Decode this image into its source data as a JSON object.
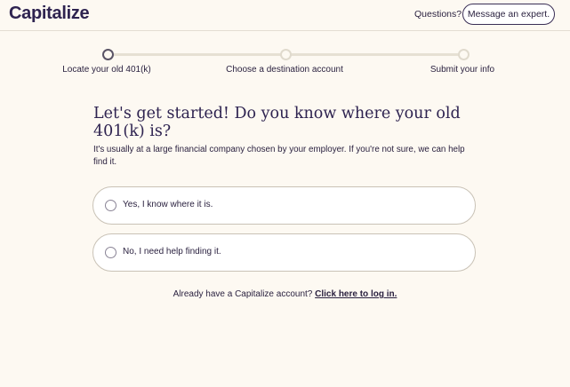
{
  "header": {
    "logo": "Capitalize",
    "questions_label": "Questions?",
    "message_button": "Message an expert."
  },
  "progress": {
    "current_step": 1,
    "steps": [
      {
        "label": "Locate your old 401(k)"
      },
      {
        "label": "Choose a destination account"
      },
      {
        "label": "Submit your info"
      }
    ]
  },
  "main": {
    "title": "Let's get started! Do you know where your old 401(k) is?",
    "subtitle": "It's usually at a large financial company chosen by your employer. If you're not sure, we can help find it.",
    "options": [
      {
        "label": "Yes, I know where it is."
      },
      {
        "label": "No, I need help finding it."
      }
    ]
  },
  "footer": {
    "prompt": "Already have a Capitalize account?",
    "login_link": "Click here to log in."
  },
  "colors": {
    "background": "#fdf9f2",
    "brand": "#2e2350"
  }
}
